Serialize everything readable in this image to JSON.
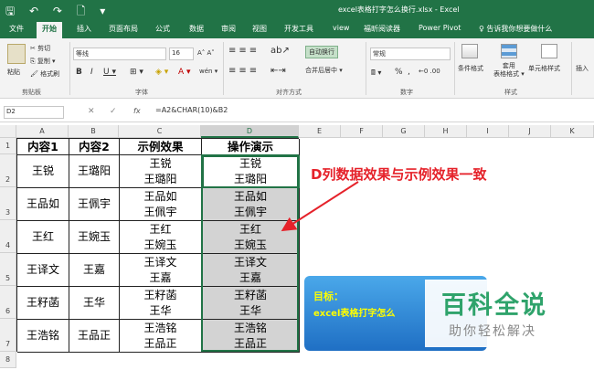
{
  "app": {
    "title": "excel表格打字怎么换行.xlsx  -  Excel",
    "quick_access": "🖫 ↶ ↷ 🗋 ▾"
  },
  "tabs": [
    "文件",
    "开始",
    "插入",
    "页面布局",
    "公式",
    "数据",
    "审阅",
    "视图",
    "开发工具",
    "view",
    "福昕阅读器",
    "Power Pivot",
    "♀ 告诉我你想要做什么"
  ],
  "active_tab": "开始",
  "ribbon": {
    "paste": "粘贴",
    "cut": "✂ 剪切",
    "copy": "⎘ 复制 ▾",
    "format_painter": "🖌 格式刷",
    "clipboard_group": "剪贴板",
    "font_name": "等线",
    "font_size": "16",
    "grow_shrink": "A˄ A˅",
    "bold": "B",
    "italic": "I",
    "underline": "U ▾",
    "border": "⊞ ▾",
    "fill": "◈ ▾",
    "font_color": "A ▾",
    "wen": "wén ▾",
    "font_group": "字体",
    "wrap_text": "自动换行",
    "merge_center": "合并后居中 ▾",
    "align_group": "对齐方式",
    "number_format": "常规",
    "currency": "🖩 ▾",
    "percent": "%",
    "comma": ",",
    "decimals": "←0 .00",
    "number_group": "数字",
    "conditional": "条件格式",
    "table_format": "套用\n表格格式 ▾",
    "cell_styles": "单元格样式",
    "styles_group": "样式",
    "insert": "插入"
  },
  "formula_bar": {
    "name_box": "D2",
    "formula": "=A2&CHAR(10)&B2"
  },
  "columns": [
    "A",
    "B",
    "C",
    "D",
    "E",
    "F",
    "G",
    "H",
    "I",
    "J",
    "K"
  ],
  "rows": [
    "1",
    "2",
    "3",
    "4",
    "5",
    "6",
    "7",
    "8"
  ],
  "table": {
    "headers": [
      "内容1",
      "内容2",
      "示例效果",
      "操作演示"
    ],
    "rows": [
      {
        "a": "王锐",
        "b": "王璐阳",
        "c": "王锐\n王璐阳",
        "d": "王锐\n王璐阳"
      },
      {
        "a": "王品如",
        "b": "王佩宇",
        "c": "王品如\n王佩宇",
        "d": "王品如\n王佩宇"
      },
      {
        "a": "王红",
        "b": "王婉玉",
        "c": "王红\n王婉玉",
        "d": "王红\n王婉玉"
      },
      {
        "a": "王译文",
        "b": "王嘉",
        "c": "王译文\n王嘉",
        "d": "王译文\n王嘉"
      },
      {
        "a": "王籽菡",
        "b": "王华",
        "c": "王籽菡\n王华",
        "d": "王籽菡\n王华"
      },
      {
        "a": "王浩铭",
        "b": "王品正",
        "c": "王浩铭\n王品正",
        "d": "王浩铭\n王品正"
      }
    ]
  },
  "callout": "D列数据效果与示例效果一致",
  "banner": {
    "line1": "目标：",
    "line2": "excel表格打字怎么"
  },
  "watermark": {
    "brand": "百科全说",
    "slogan": "助你轻松解决"
  },
  "colors": {
    "excel_green": "#217346",
    "callout_red": "#e5222a",
    "selection_gray": "#d3d3d3"
  }
}
